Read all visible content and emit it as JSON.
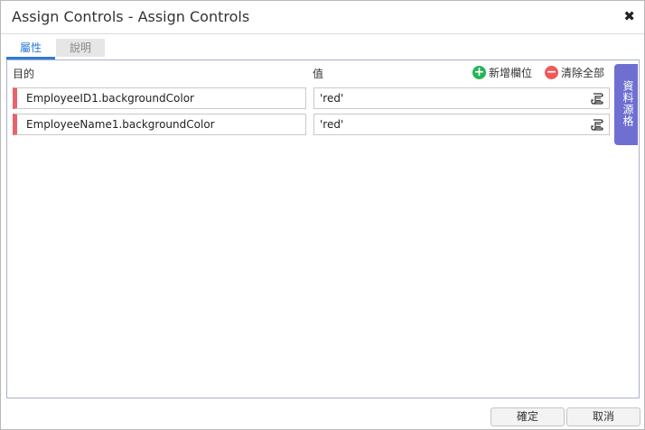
{
  "dialog": {
    "title": "Assign Controls - Assign Controls",
    "close_glyph": "✖"
  },
  "tabs": [
    {
      "label": "屬性",
      "active": true
    },
    {
      "label": "說明",
      "active": false
    }
  ],
  "table": {
    "header_target": "目的",
    "header_value": "值",
    "add_label": "新增欄位",
    "clear_label": "清除全部",
    "add_glyph": "+",
    "clear_glyph": "−",
    "rows": [
      {
        "target": "EmployeeID1.backgroundColor",
        "value": "'red'"
      },
      {
        "target": "EmployeeName1.backgroundColor",
        "value": "'red'"
      }
    ]
  },
  "side_tab": {
    "label": "資料源格"
  },
  "footer": {
    "ok_label": "確定",
    "cancel_label": "取消"
  },
  "colors": {
    "accent": "#2f7bd9",
    "add": "#25b454",
    "clear": "#ee5b5b",
    "row_marker": "#e8626c",
    "side_tab": "#6f6fd2"
  },
  "icons": {
    "close": "close-icon",
    "add": "plus-circle-icon",
    "clear": "minus-circle-icon",
    "value_editor": "scroll-icon"
  }
}
